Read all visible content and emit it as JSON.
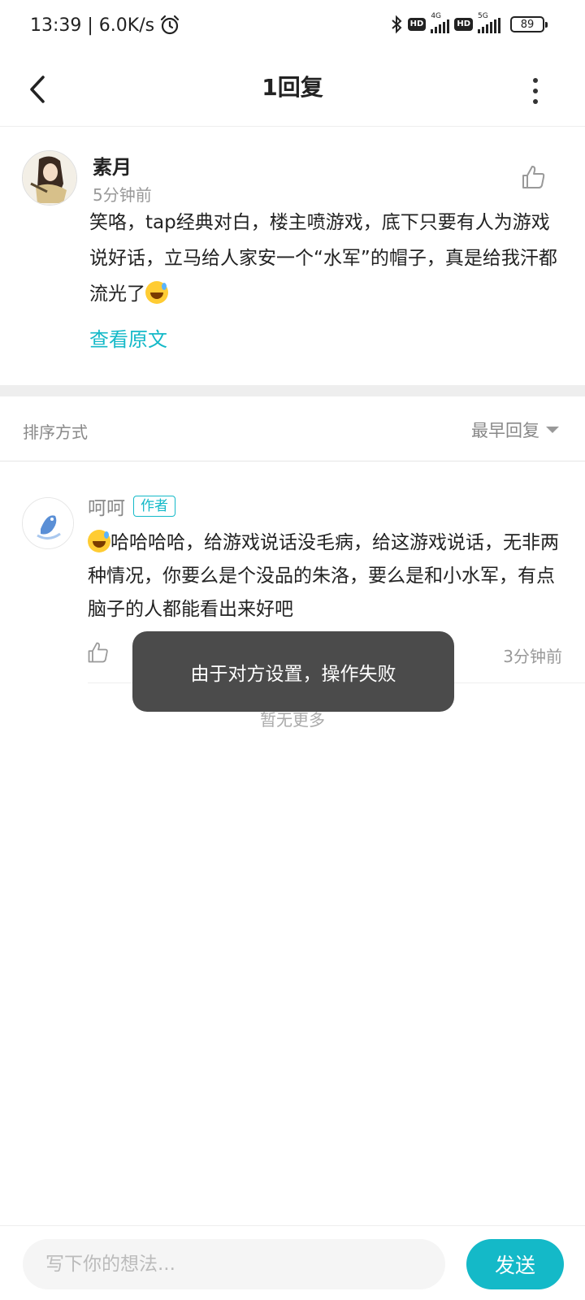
{
  "status_bar": {
    "time_speed": "13:39 | 6.0K/s",
    "net1": "4G",
    "net2": "5G",
    "hd": "HD",
    "battery": "89"
  },
  "header": {
    "title": "1回复"
  },
  "main_comment": {
    "author": "素月",
    "time": "5分钟前",
    "content": "笑咯，tap经典对白，楼主喷游戏，底下只要有人为游戏说好话，立马给人家安一个“水军”的帽子，真是给我汗都流光了",
    "view_original": "查看原文"
  },
  "sort": {
    "label": "排序方式",
    "value": "最早回复"
  },
  "reply": {
    "author": "呵呵",
    "badge": "作者",
    "content": "哈哈哈哈，给游戏说话没毛病，给这游戏说话，无非两种情况，你要么是个没品的朱洛，要么是和小水军，有点脑子的人都能看出来好吧",
    "time": "3分钟前"
  },
  "no_more": "暂无更多",
  "toast": "由于对方设置，操作失败",
  "bottom": {
    "placeholder": "写下你的想法...",
    "send": "发送"
  },
  "colors": {
    "accent": "#14b9c8",
    "toast_bg": "#4b4b4b"
  }
}
